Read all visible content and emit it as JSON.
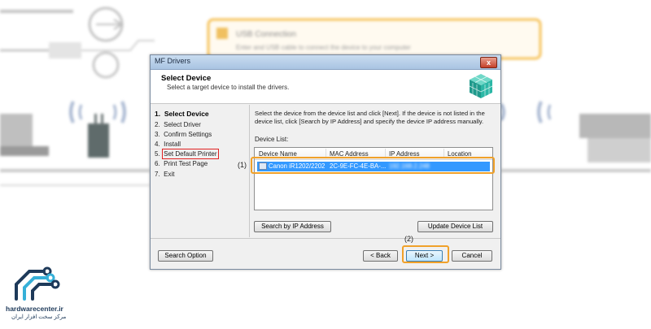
{
  "dialog": {
    "title": "MF Drivers",
    "close_glyph": "x",
    "header_title": "Select Device",
    "header_subtitle": "Select a target device to install the drivers.",
    "steps": [
      {
        "number": "1.",
        "label": "Select Device",
        "active": true
      },
      {
        "number": "2.",
        "label": "Select Driver",
        "active": false
      },
      {
        "number": "3.",
        "label": "Confirm Settings",
        "active": false
      },
      {
        "number": "4.",
        "label": "Install",
        "active": false
      },
      {
        "number": "5.",
        "label": "Set Default Printer",
        "active": false
      },
      {
        "number": "6.",
        "label": "Print Test Page",
        "active": false
      },
      {
        "number": "7.",
        "label": "Exit",
        "active": false
      }
    ],
    "instructions": "Select the device from the device list and click [Next]. If the device is not listed in the device list, click [Search by IP Address] and specify the device IP address manually.",
    "device_list_label": "Device List:",
    "columns": [
      "Device Name",
      "MAC Address",
      "IP Address",
      "Location"
    ],
    "selected_row": {
      "device_name": "Canon iR1202/2202",
      "mac_address": "2C-9E-FC-4E-BA-...",
      "ip_address": "192.168.2.248",
      "location": ""
    },
    "buttons": {
      "search_by_ip": "Search by IP Address",
      "update_list": "Update Device List",
      "search_option": "Search Option",
      "back": "< Back",
      "next": "Next >",
      "cancel": "Cancel"
    }
  },
  "annotations": {
    "callout_1": "(1)",
    "callout_2": "(2)",
    "highlight_color": "#f0a12a",
    "step_highlight_color": "#e02020"
  },
  "background": {
    "blurred_box_title": "USB Connection",
    "blurred_box_text": "Enter and USB cable to connect the device to your computer"
  },
  "logo": {
    "name": "hardwarecenter.ir",
    "subtitle": "مرکز سخت افزار ایران"
  },
  "colors": {
    "selection": "#3399ff",
    "titlebar": "#b8cfe8",
    "window_bg": "#f0f0f0"
  }
}
